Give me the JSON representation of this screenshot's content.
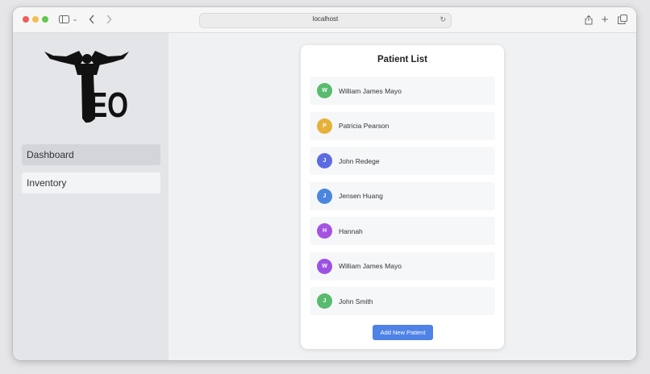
{
  "browser": {
    "url": "localhost"
  },
  "sidebar": {
    "items": [
      {
        "label": "Dashboard",
        "active": true
      },
      {
        "label": "Inventory",
        "active": false
      }
    ]
  },
  "main": {
    "title": "Patient List",
    "patients": [
      {
        "initial": "W",
        "name": "William James Mayo",
        "color": "#58bb6e"
      },
      {
        "initial": "P",
        "name": "Patricia Pearson",
        "color": "#e6b13a"
      },
      {
        "initial": "J",
        "name": "John Redege",
        "color": "#5d6be3"
      },
      {
        "initial": "J",
        "name": "Jensen Huang",
        "color": "#4a86e0"
      },
      {
        "initial": "H",
        "name": "Hannah",
        "color": "#a552e2"
      },
      {
        "initial": "W",
        "name": "William James Mayo",
        "color": "#9b52e4"
      },
      {
        "initial": "J",
        "name": "John Smith",
        "color": "#58bb6e"
      }
    ],
    "add_button_label": "Add New Patient"
  },
  "colors": {
    "accent": "#4f82e6",
    "sidebar_bg": "#e4e5e9",
    "main_bg": "#f0f1f3"
  }
}
